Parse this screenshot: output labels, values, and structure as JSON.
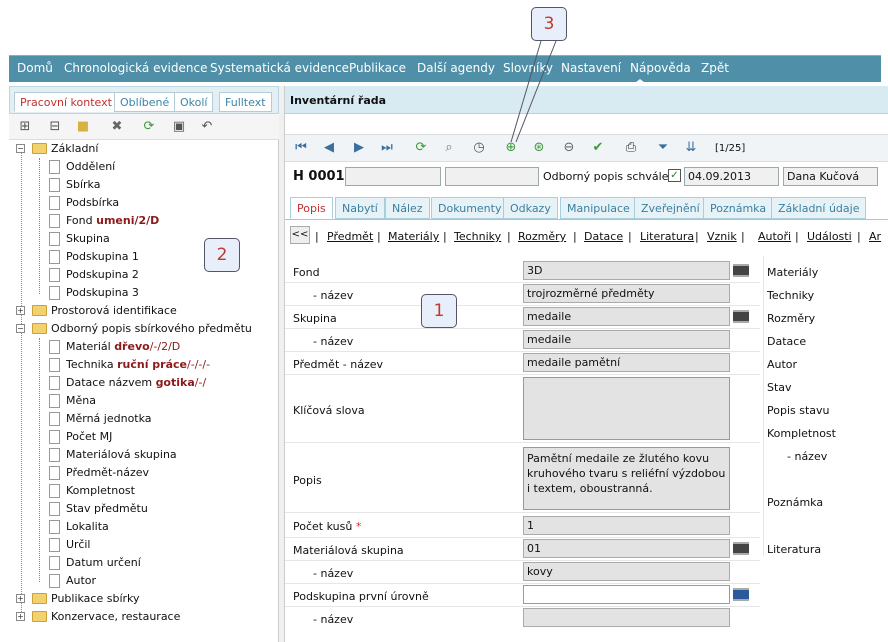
{
  "menu": {
    "items": [
      "Domů",
      "Chronologická evidence",
      "Systematická evidence",
      "Publikace",
      "Další agendy",
      "Slovníky",
      "Nastavení",
      "Nápověda",
      "Zpět"
    ]
  },
  "left_tabs": [
    "Pracovní kontext",
    "Oblíbené",
    "Okolí",
    "Fulltext"
  ],
  "tree": {
    "zakladni": "Základní",
    "oddeleni": "Oddělení",
    "sbirka": "Sbírka",
    "podsbirka": "Podsbírka",
    "fond": "Fond ",
    "fond_val": "umeni/2/D",
    "skupina": "Skupina",
    "podskupina1": "Podskupina 1",
    "podskupina2": "Podskupina 2",
    "podskupina3": "Podskupina 3",
    "prostorova": "Prostorová identifikace",
    "odborny": "Odborný popis sbírkového předmětu",
    "material": "Materiál ",
    "material_val": "dřevo",
    "material_rest": "/-/2/D",
    "technika": "Technika ",
    "technika_val": "ruční práce",
    "technika_rest": "/-/-/-",
    "datace": "Datace názvem ",
    "datace_val": "gotika",
    "datace_rest": "/-/",
    "mena": "Měna",
    "merna": "Měrná jednotka",
    "pocet_mj": "Počet MJ",
    "matskup": "Materiálová skupina",
    "predmet": "Předmět-název",
    "kompletnost": "Kompletnost",
    "stav": "Stav předmětu",
    "lokalita": "Lokalita",
    "urcil": "Určil",
    "datum": "Datum určení",
    "autor": "Autor",
    "publikace": "Publikace sbírky",
    "konzervace": "Konzervace, restaurace"
  },
  "panel": {
    "title": "Inventární řada",
    "counter": "[1/25]"
  },
  "header": {
    "number": "H 0001",
    "approved_label": "Odborný popis schválen",
    "date": "04.09.2013",
    "user": "Dana Kučová"
  },
  "tabs": [
    "Popis",
    "Nabytí",
    "Nález",
    "Dokumenty",
    "Odkazy",
    "Manipulace",
    "Zveřejnění",
    "Poznámka",
    "Základní údaje"
  ],
  "sublinks": {
    "back": "<<",
    "items": [
      "Předmět",
      "Materiály",
      "Techniky",
      "Rozměry",
      "Datace",
      "Literatura",
      "Vznik",
      "Autoři",
      "Události",
      "Ar"
    ]
  },
  "form": {
    "fond": "Fond",
    "fond_val": "3D",
    "nazev": "- název",
    "fond_nazev": "trojrozměrné předměty",
    "skupina": "Skupina",
    "skupina_val": "medaile",
    "skupina_nazev": "medaile",
    "predmet": "Předmět - název",
    "predmet_val": "medaile pamětní",
    "klicova": "Klíčová slova",
    "popis": "Popis",
    "popis_val": "Pamětní medaile ze žlutého kovu kruhového tvaru s reliéfní výzdobou i textem, oboustranná.",
    "pocet": "Počet kusů",
    "required": "*",
    "pocet_val": "1",
    "matskup": "Materiálová skupina",
    "matskup_val": "01",
    "matskup_nazev": "kovy",
    "podskupina": "Podskupina první úrovně"
  },
  "right_labels": [
    "Materiály",
    "Techniky",
    "Rozměry",
    "Datace",
    "Autor",
    "Stav",
    "Popis stavu",
    "Kompletnost",
    "- název",
    "Poznámka",
    "Literatura"
  ],
  "callouts": [
    "1",
    "2",
    "3"
  ]
}
